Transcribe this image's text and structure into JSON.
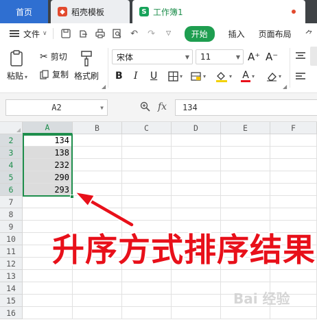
{
  "tabs": {
    "home": "首页",
    "templates": "稻壳模板",
    "workbook": "工作簿1",
    "workbook_icon": "S"
  },
  "menu": {
    "file": "文件",
    "start": "开始",
    "insert": "插入",
    "page_layout": "页面布局"
  },
  "ribbon": {
    "paste": "粘贴",
    "cut": "剪切",
    "copy": "复制",
    "format_painter": "格式刷",
    "font_name": "宋体",
    "font_size": "11",
    "bold": "B",
    "italic": "I",
    "underline": "U",
    "font_color_letter": "A",
    "grow_font": "A⁺",
    "shrink_font": "A⁻"
  },
  "formula_bar": {
    "cell_ref": "A2",
    "fx": "fx",
    "value": "134"
  },
  "sheet": {
    "columns": [
      "A",
      "B",
      "C",
      "D",
      "E",
      "F"
    ],
    "rows": [
      "2",
      "3",
      "4",
      "5",
      "6",
      "7",
      "8",
      "9",
      "10",
      "11",
      "12",
      "13",
      "14",
      "15",
      "16"
    ],
    "values": [
      "134",
      "138",
      "232",
      "290",
      "293"
    ]
  },
  "annotation": "升序方式排序结果",
  "watermark": "Bai 经验",
  "colors": {
    "accent_green": "#1e8e4c",
    "annotation_red": "#e8101a",
    "home_tab_blue": "#2f6fd1"
  }
}
